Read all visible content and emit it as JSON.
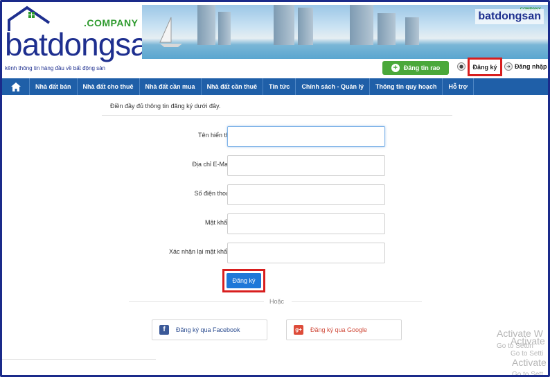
{
  "header": {
    "logo_main": "batdongsan",
    "logo_suffix": ".COMPANY",
    "tagline": "kênh thông tin hàng đầu về bất động sản",
    "banner_logo": "batdongsan",
    "banner_logo_suffix": "COMPANY",
    "post_button": "Đăng tin rao",
    "signup_link": "Đăng ký",
    "login_link": "Đăng nhập"
  },
  "nav": {
    "items": [
      "Nhà đất bán",
      "Nhà đất cho thuê",
      "Nhà đất cần mua",
      "Nhà đất cần thuê",
      "Tin tức",
      "Chính sách - Quản lý",
      "Thông tin quy hoạch",
      "Hỗ trợ"
    ]
  },
  "form": {
    "intro": "Điền đầy đủ thông tin đăng ký dưới đây.",
    "fields": [
      {
        "label": "Tên hiển thị",
        "value": "",
        "placeholder": ""
      },
      {
        "label": "Địa chỉ E-Mail",
        "value": "",
        "placeholder": ""
      },
      {
        "label": "Số điện thoại",
        "value": "",
        "placeholder": ""
      },
      {
        "label": "Mật khẩu",
        "value": "",
        "placeholder": ""
      },
      {
        "label": "Xác nhận lại mật khẩu",
        "value": "",
        "placeholder": ""
      }
    ],
    "submit": "Đăng ký",
    "or_text": "Hoặc",
    "facebook_button": "Đăng ký qua Facebook",
    "google_button": "Đăng ký qua Google"
  },
  "watermark": {
    "line1": "Activate W",
    "line2": "Go to Settin",
    "line3": "Activate",
    "line4": "Go to Setti",
    "line5": "Activate",
    "line6": "Go to Sett"
  },
  "colors": {
    "nav_bg": "#1f5fa8",
    "post_button_bg": "#4aa83a",
    "submit_bg": "#1e78d8",
    "highlight_border": "#d81e1e",
    "logo_blue": "#1e2f8f"
  }
}
